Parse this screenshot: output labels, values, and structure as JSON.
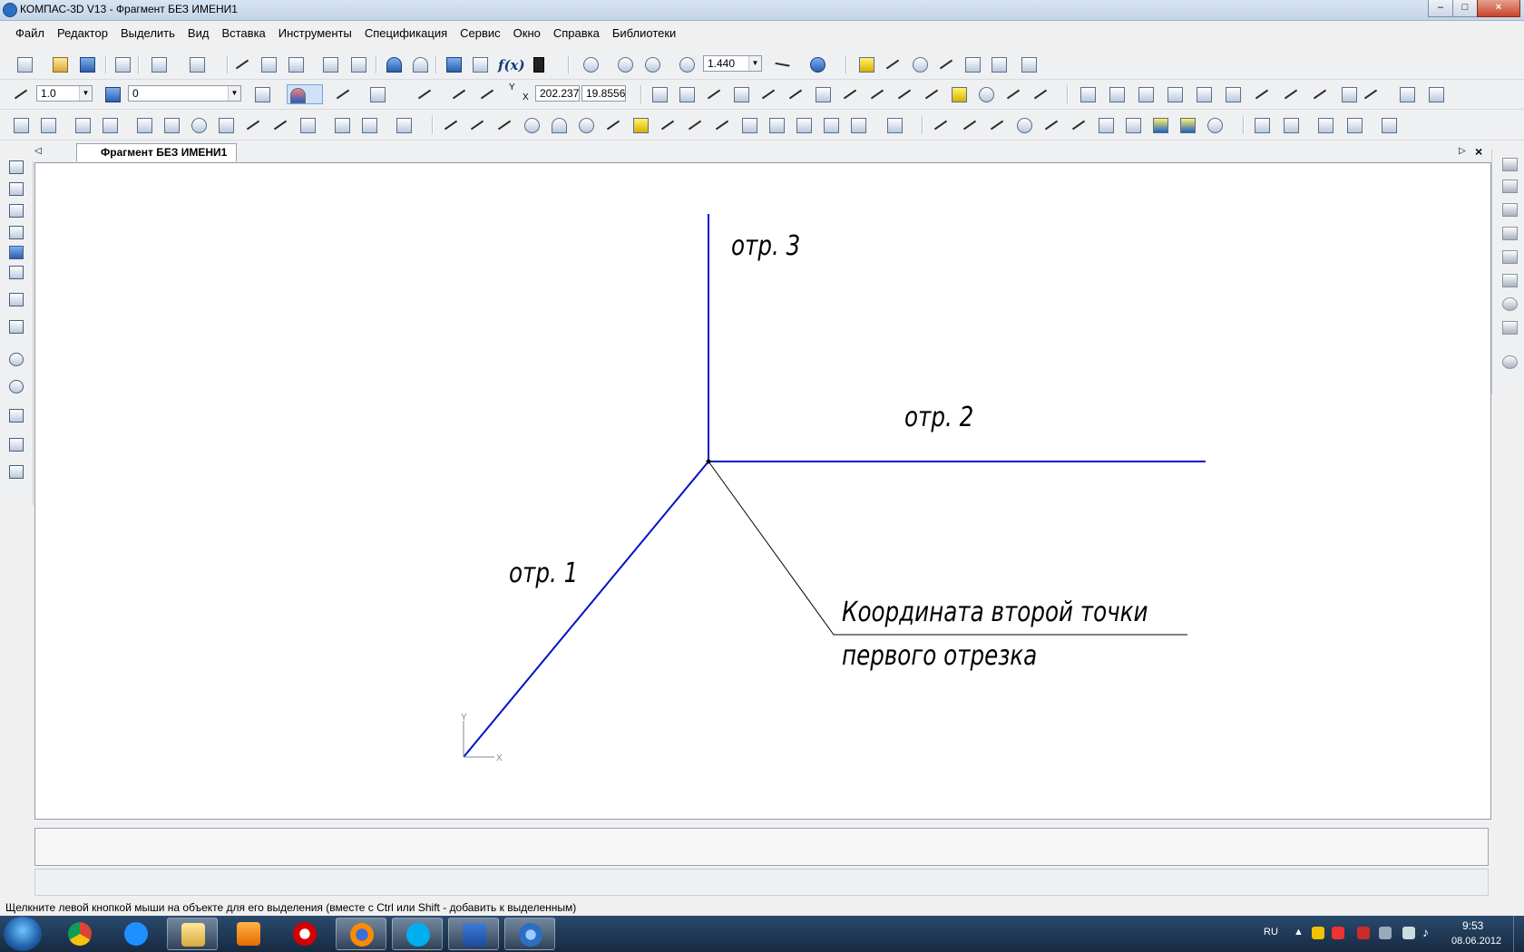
{
  "window": {
    "title": "КОМПАС-3D V13 - Фрагмент БЕЗ ИМЕНИ1",
    "controls": [
      "–",
      "□",
      "×"
    ]
  },
  "menu": [
    "Файл",
    "Редактор",
    "Выделить",
    "Вид",
    "Вставка",
    "Инструменты",
    "Спецификация",
    "Сервис",
    "Окно",
    "Справка",
    "Библиотеки"
  ],
  "toolbar": {
    "zoom_value": "1.440",
    "line_scale": "1.0",
    "layer": "0",
    "coord_x": "202.237",
    "coord_y": "19.8556",
    "fx_label": "f(x)",
    "y_label": "Y",
    "x_label": "X"
  },
  "document": {
    "tab_label": "Фрагмент БЕЗ ИМЕНИ1"
  },
  "drawing": {
    "labels": {
      "segment_1": "отр. 1",
      "segment_2": "отр. 2",
      "segment_3": "отр. 3",
      "note_line1": "Координата второй точки",
      "note_line2": "первого отрезка"
    },
    "axis_x": "X",
    "axis_y": "Y",
    "segment_color": "#0010c8",
    "leader_color": "#000000"
  },
  "status_bar": {
    "hint": "Щелкните левой кнопкой мыши на объекте для его выделения (вместе с Ctrl или Shift - добавить к выделенным)"
  },
  "taskbar": {
    "apps": [
      "chrome-icon",
      "ie-icon",
      "explorer-icon",
      "media-icon",
      "opera-icon",
      "firefox-icon",
      "skype-icon",
      "word-icon",
      "kompas-icon"
    ],
    "language": "RU",
    "time": "9:53",
    "date": "08.06.2012"
  },
  "colors": {
    "accent": "#2b5fb0",
    "taskbar": "#1f3856",
    "canvas": "#ffffff"
  }
}
